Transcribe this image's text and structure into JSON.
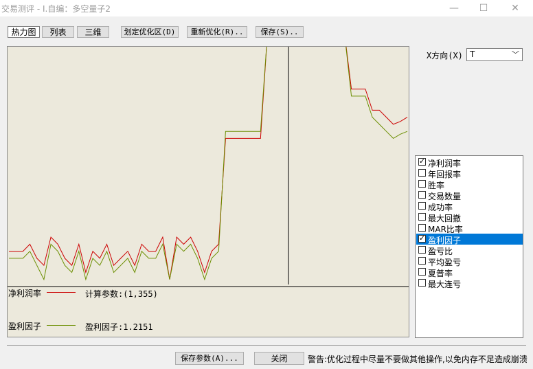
{
  "window": {
    "title": "交易测评 - I.自编：多空量子2",
    "minimize_glyph": "—",
    "maximize_glyph": "☐",
    "close_glyph": "✕"
  },
  "toolbar": {
    "heatmap_tab": "热力图",
    "list_tab": "列表",
    "three_d_tab": "三维",
    "define_range": "划定优化区(D)",
    "reoptimize": "重新优化(R)..",
    "save": "保存(S).."
  },
  "x_axis": {
    "label": "X方向(X)",
    "selected": "T"
  },
  "legend": [
    {
      "name": "净利润率",
      "color": "#cc0000",
      "info": "计算参数:(1,355)"
    },
    {
      "name": "盈利因子",
      "color": "#6b8e00",
      "info": "盈利因子:1.2151"
    }
  ],
  "metrics": [
    {
      "label": "净利润率",
      "checked": true,
      "selected": false
    },
    {
      "label": "年回报率",
      "checked": false,
      "selected": false
    },
    {
      "label": "胜率",
      "checked": false,
      "selected": false
    },
    {
      "label": "交易数量",
      "checked": false,
      "selected": false
    },
    {
      "label": "成功率",
      "checked": false,
      "selected": false
    },
    {
      "label": "最大回撤",
      "checked": false,
      "selected": false
    },
    {
      "label": "MAR比率",
      "checked": false,
      "selected": false
    },
    {
      "label": "盈利因子",
      "checked": true,
      "selected": true
    },
    {
      "label": "盈亏比",
      "checked": false,
      "selected": false
    },
    {
      "label": "平均盈亏",
      "checked": false,
      "selected": false
    },
    {
      "label": "夏普率",
      "checked": false,
      "selected": false
    },
    {
      "label": "最大连亏",
      "checked": false,
      "selected": false
    }
  ],
  "footer": {
    "save_params": "保存参数(A)...",
    "close": "关闭",
    "warning": "警告:优化过程中尽量不要做其他操作,以免内存不足造成崩溃"
  },
  "colors": {
    "chart_bg": "#ece9dc",
    "net_profit_line": "#cc0000",
    "profit_factor_line": "#6b8e00",
    "selection": "#0078d7"
  },
  "chart_data": {
    "type": "line",
    "title": "",
    "xlabel": "",
    "ylabel": "",
    "cursor_param": "(1,355)",
    "series": [
      {
        "name": "净利润率",
        "values": [
          0.05,
          0.05,
          0.05,
          0.1,
          0.0,
          -0.05,
          0.15,
          0.1,
          0.0,
          -0.05,
          0.1,
          -0.1,
          0.05,
          0.0,
          0.1,
          -0.05,
          0.0,
          0.05,
          -0.05,
          0.1,
          0.05,
          0.05,
          0.15,
          -0.15,
          0.15,
          0.1,
          0.15,
          0.05,
          -0.1,
          0.05,
          0.1,
          0.85,
          0.85,
          0.85,
          0.85,
          0.85,
          0.85,
          1.6,
          1.6,
          1.6,
          1.6,
          1.6,
          1.6,
          1.6,
          1.6,
          1.6,
          1.6,
          1.6,
          1.6,
          1.2,
          1.2,
          1.2,
          1.05,
          1.05,
          1.0,
          0.95,
          0.97,
          1.0
        ]
      },
      {
        "name": "盈利因子",
        "values": [
          0.0,
          0.0,
          0.0,
          0.05,
          -0.05,
          -0.15,
          0.1,
          0.05,
          -0.05,
          -0.1,
          0.05,
          -0.15,
          0.0,
          -0.05,
          0.05,
          -0.1,
          -0.05,
          0.0,
          -0.1,
          0.05,
          0.0,
          0.0,
          0.1,
          -0.15,
          0.1,
          0.05,
          0.1,
          0.0,
          -0.15,
          0.0,
          0.05,
          0.9,
          0.9,
          0.9,
          0.9,
          0.9,
          0.9,
          1.6,
          1.6,
          1.6,
          1.6,
          1.6,
          1.6,
          1.6,
          1.6,
          1.6,
          1.6,
          1.6,
          1.6,
          1.15,
          1.15,
          1.15,
          1.0,
          0.95,
          0.9,
          0.85,
          0.88,
          0.9
        ]
      }
    ]
  }
}
